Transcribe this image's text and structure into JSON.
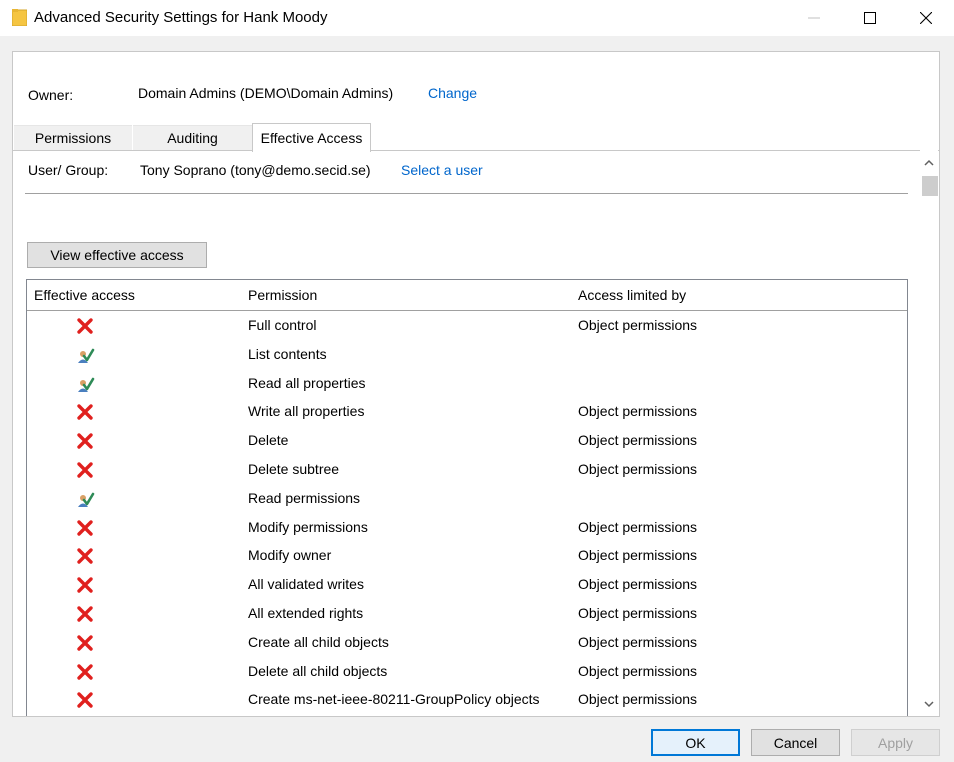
{
  "window": {
    "title": "Advanced Security Settings for Hank Moody",
    "folder_icon": "folder-icon"
  },
  "owner": {
    "label": "Owner:",
    "value": "Domain Admins (DEMO\\Domain Admins)",
    "change_link": "Change"
  },
  "tabs": [
    {
      "label": "Permissions",
      "selected": false
    },
    {
      "label": "Auditing",
      "selected": false
    },
    {
      "label": "Effective Access",
      "selected": true
    }
  ],
  "user_group": {
    "label": "User/ Group:",
    "value": "Tony Soprano (tony@demo.secid.se)",
    "select_link": "Select a user"
  },
  "view_button": "View effective access",
  "grid": {
    "headers": [
      "Effective access",
      "Permission",
      "Access limited by"
    ],
    "rows": [
      {
        "access": "denied",
        "permission": "Full control",
        "limited_by": "Object permissions"
      },
      {
        "access": "allowed",
        "permission": "List contents",
        "limited_by": ""
      },
      {
        "access": "allowed",
        "permission": "Read all properties",
        "limited_by": ""
      },
      {
        "access": "denied",
        "permission": "Write all properties",
        "limited_by": "Object permissions"
      },
      {
        "access": "denied",
        "permission": "Delete",
        "limited_by": "Object permissions"
      },
      {
        "access": "denied",
        "permission": "Delete subtree",
        "limited_by": "Object permissions"
      },
      {
        "access": "allowed",
        "permission": "Read permissions",
        "limited_by": ""
      },
      {
        "access": "denied",
        "permission": "Modify permissions",
        "limited_by": "Object permissions"
      },
      {
        "access": "denied",
        "permission": "Modify owner",
        "limited_by": "Object permissions"
      },
      {
        "access": "denied",
        "permission": "All validated writes",
        "limited_by": "Object permissions"
      },
      {
        "access": "denied",
        "permission": "All extended rights",
        "limited_by": "Object permissions"
      },
      {
        "access": "denied",
        "permission": "Create all child objects",
        "limited_by": "Object permissions"
      },
      {
        "access": "denied",
        "permission": "Delete all child objects",
        "limited_by": "Object permissions"
      },
      {
        "access": "denied",
        "permission": "Create ms-net-ieee-80211-GroupPolicy objects",
        "limited_by": "Object permissions"
      }
    ]
  },
  "buttons": {
    "ok": "OK",
    "cancel": "Cancel",
    "apply": "Apply"
  },
  "colors": {
    "link": "#0066cc",
    "deny": "#e0201e",
    "allow_check": "#2e8b57",
    "ok_border": "#0078d7"
  }
}
